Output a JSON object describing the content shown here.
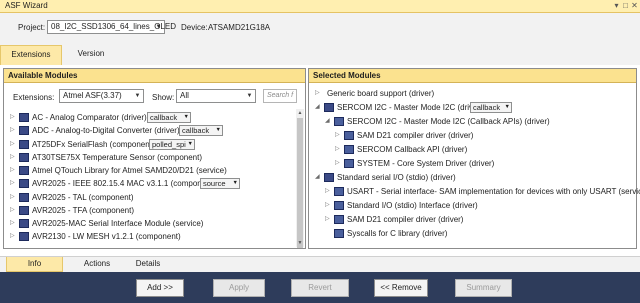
{
  "window": {
    "title": "ASF Wizard",
    "pin_glyph": "▾",
    "close_glyph": "✕",
    "maximize_glyph": "□"
  },
  "project": {
    "label": "Project:",
    "value": "08_I2C_SSD1306_64_lines_OLED",
    "device_label": "Device:",
    "device_value": "ATSAMD21G18A"
  },
  "tabs": [
    {
      "label": "Extensions",
      "selected": true
    },
    {
      "label": "Version",
      "selected": false
    }
  ],
  "available": {
    "header": "Available Modules",
    "extensions_label": "Extensions:",
    "extensions_value": "Atmel ASF(3.37)",
    "show_label": "Show:",
    "show_value": "All",
    "search_placeholder": "Search f",
    "items": [
      {
        "label": "AC - Analog Comparator (driver)",
        "option": "callback"
      },
      {
        "label": "ADC - Analog-to-Digital Converter (driver)",
        "option": "callback"
      },
      {
        "label": "AT25DFx SerialFlash (component)",
        "option": "polled_spi"
      },
      {
        "label": "AT30TSE75X Temperature Sensor (component)",
        "option": ""
      },
      {
        "label": "Atmel QTouch Library for Atmel SAMD20/D21 (service)",
        "option": ""
      },
      {
        "label": "AVR2025 - IEEE 802.15.4 MAC v3.1.1 (component)",
        "option": "source"
      },
      {
        "label": "AVR2025 - TAL (component)",
        "option": ""
      },
      {
        "label": "AVR2025 - TFA (component)",
        "option": ""
      },
      {
        "label": "AVR2025-MAC Serial Interface Module (service)",
        "option": ""
      },
      {
        "label": "AVR2130 - LW MESH v1.2.1 (component)",
        "option": ""
      }
    ]
  },
  "selected": {
    "header": "Selected Modules",
    "items": [
      {
        "label": "Generic board support (driver)",
        "option": ""
      },
      {
        "label": "SERCOM I2C - Master Mode I2C (driver)",
        "option": "callback"
      },
      {
        "label": "SERCOM I2C - Master Mode I2C (Callback APIs) (driver)",
        "option": ""
      },
      {
        "label": "SAM D21 compiler driver (driver)",
        "option": ""
      },
      {
        "label": "SERCOM Callback API (driver)",
        "option": ""
      },
      {
        "label": "SYSTEM - Core System Driver (driver)",
        "option": ""
      },
      {
        "label": "Standard serial I/O (stdio) (driver)",
        "option": ""
      },
      {
        "label": "USART - Serial interface- SAM implementation for devices with only USART (service)",
        "option": ""
      },
      {
        "label": "Standard I/O (stdio) Interface (driver)",
        "option": ""
      },
      {
        "label": "SAM D21 compiler driver (driver)",
        "option": ""
      },
      {
        "label": "Syscalls for C library (driver)",
        "option": ""
      }
    ]
  },
  "bottom_tabs": [
    {
      "label": "Info",
      "selected": true
    },
    {
      "label": "Actions",
      "selected": false
    },
    {
      "label": "Details",
      "selected": false
    }
  ],
  "buttons": {
    "add": "Add >>",
    "apply": "Apply",
    "revert": "Revert",
    "remove": "<< Remove",
    "summary": "Summary"
  },
  "colors": {
    "title_bar": "#ffefb0",
    "pane_header": "#fbe28f",
    "footer": "#2e3c5b"
  }
}
